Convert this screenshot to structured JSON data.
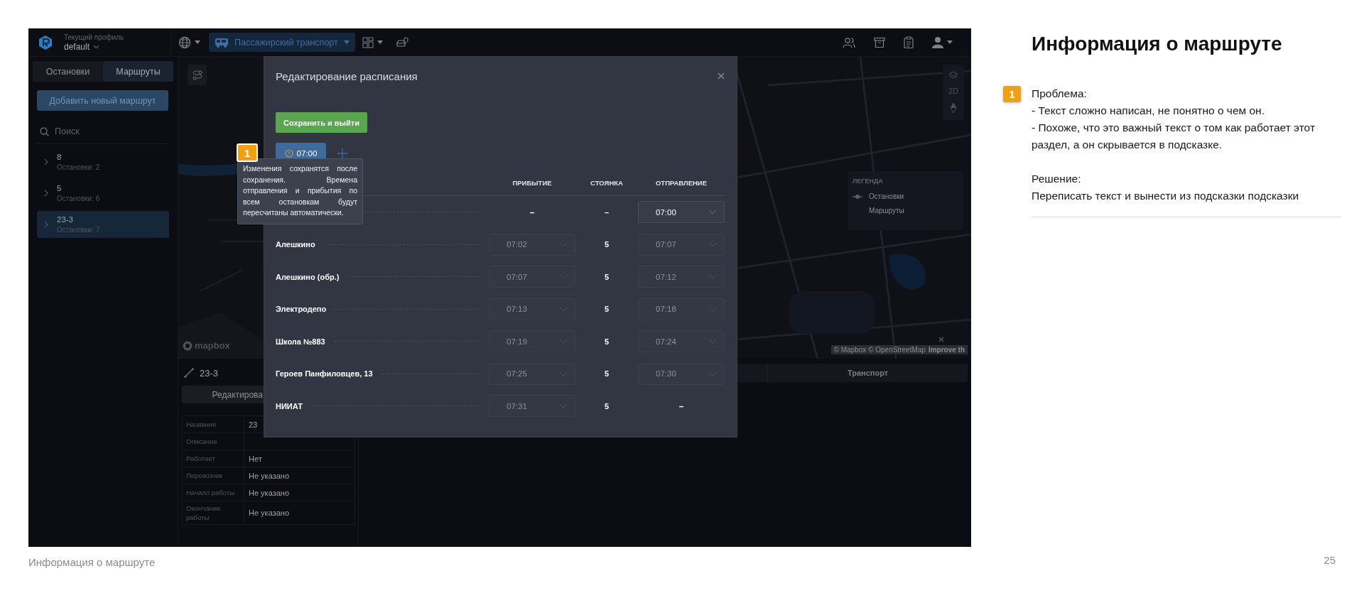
{
  "app": {
    "topbar": {
      "profile_label": "Текущий профиль",
      "profile": "default",
      "transport": "Пассажирский транспорт"
    },
    "sidebar": {
      "tabs": [
        {
          "label": "Остановки",
          "selected": false
        },
        {
          "label": "Маршруты",
          "selected": true
        }
      ],
      "add_button": "Добавить новый маршрут",
      "search": {
        "placeholder": "Поиск"
      },
      "routes": [
        {
          "title": "8",
          "subtitle": "Остановки: 2",
          "selected": false
        },
        {
          "title": "5",
          "subtitle": "Остановки: 6",
          "selected": false
        },
        {
          "title": "23-3",
          "subtitle": "Остановки: 7",
          "selected": true
        }
      ]
    },
    "map": {
      "logo": "mapbox",
      "attribution": "© Mapbox © OpenStreetMap",
      "attribution_link": "Improve th",
      "controls": {
        "mode": "2D"
      },
      "legend": {
        "title": "ЛЕГЕНДА",
        "items": [
          {
            "label": "Остановки",
            "kind": "stop"
          },
          {
            "label": "Маршруты",
            "kind": "route"
          }
        ]
      }
    },
    "route_info": {
      "title": "23-3",
      "edit_button": "Редактирова",
      "properties": [
        {
          "label": "Название",
          "value": "23"
        },
        {
          "label": "Описание"
        },
        {
          "label": "Работает",
          "value": "Нет"
        },
        {
          "label": "Перевозчик",
          "value": "Не указано"
        },
        {
          "label": "Начало работы",
          "value": "Не указано"
        },
        {
          "label": "Окончание работы",
          "value": "Не указано"
        }
      ],
      "tabs": [
        {
          "label": "Транспорт"
        }
      ]
    },
    "modal": {
      "title": "Редактирование расписания",
      "save_button": "Сохранить и выйти",
      "time_chip": "07:00",
      "columns": [
        "ПРИБЫТИЕ",
        "СТОЯНКА",
        "ОТПРАВЛЕНИЕ"
      ],
      "rows": [
        {
          "arrival": {
            "kind": "text",
            "text": "–"
          },
          "stop": "–",
          "departure": {
            "kind": "select",
            "value": "07:00",
            "disabled": false
          }
        },
        {
          "name": "Алешкино",
          "arrival": {
            "kind": "select",
            "value": "07:02",
            "disabled": true
          },
          "stop": "5",
          "departure": {
            "kind": "select",
            "value": "07:07",
            "disabled": true
          }
        },
        {
          "name": "Алешкино (обр.)",
          "arrival": {
            "kind": "select",
            "value": "07:07",
            "disabled": true
          },
          "stop": "5",
          "departure": {
            "kind": "select",
            "value": "07:12",
            "disabled": true
          }
        },
        {
          "name": "Электродепо",
          "arrival": {
            "kind": "select",
            "value": "07:13",
            "disabled": true
          },
          "stop": "5",
          "departure": {
            "kind": "select",
            "value": "07:18",
            "disabled": true
          }
        },
        {
          "name": "Школа №883",
          "arrival": {
            "kind": "select",
            "value": "07:19",
            "disabled": true
          },
          "stop": "5",
          "departure": {
            "kind": "select",
            "value": "07:24",
            "disabled": true
          }
        },
        {
          "name": "Героев Панфиловцев, 13",
          "arrival": {
            "kind": "select",
            "value": "07:25",
            "disabled": true
          },
          "stop": "5",
          "departure": {
            "kind": "select",
            "value": "07:30",
            "disabled": true
          }
        },
        {
          "name": "НИИАТ",
          "arrival": {
            "kind": "select",
            "value": "07:31",
            "disabled": true
          },
          "stop": "5",
          "departure": {
            "kind": "text",
            "text": "–"
          }
        }
      ]
    },
    "tooltip": "Изменения сохранятся после сохранения. Времена отправления и прибытия по всем остановкам будут пересчитаны автоматически.",
    "marker": "1"
  },
  "notes": {
    "title": "Информация о маршруте",
    "marker": "1",
    "problem": [
      "Проблема:",
      "- Текст сложно написан, не понятно о чем он.",
      "- Похоже, что это важный текст о том как работает этот раздел, а он скрывается в подсказке."
    ],
    "solution": [
      "Решение:",
      "Переписать текст и вынести из подсказки подсказки"
    ]
  },
  "footer": {
    "title": "Информация о маршруте",
    "page": "25"
  }
}
